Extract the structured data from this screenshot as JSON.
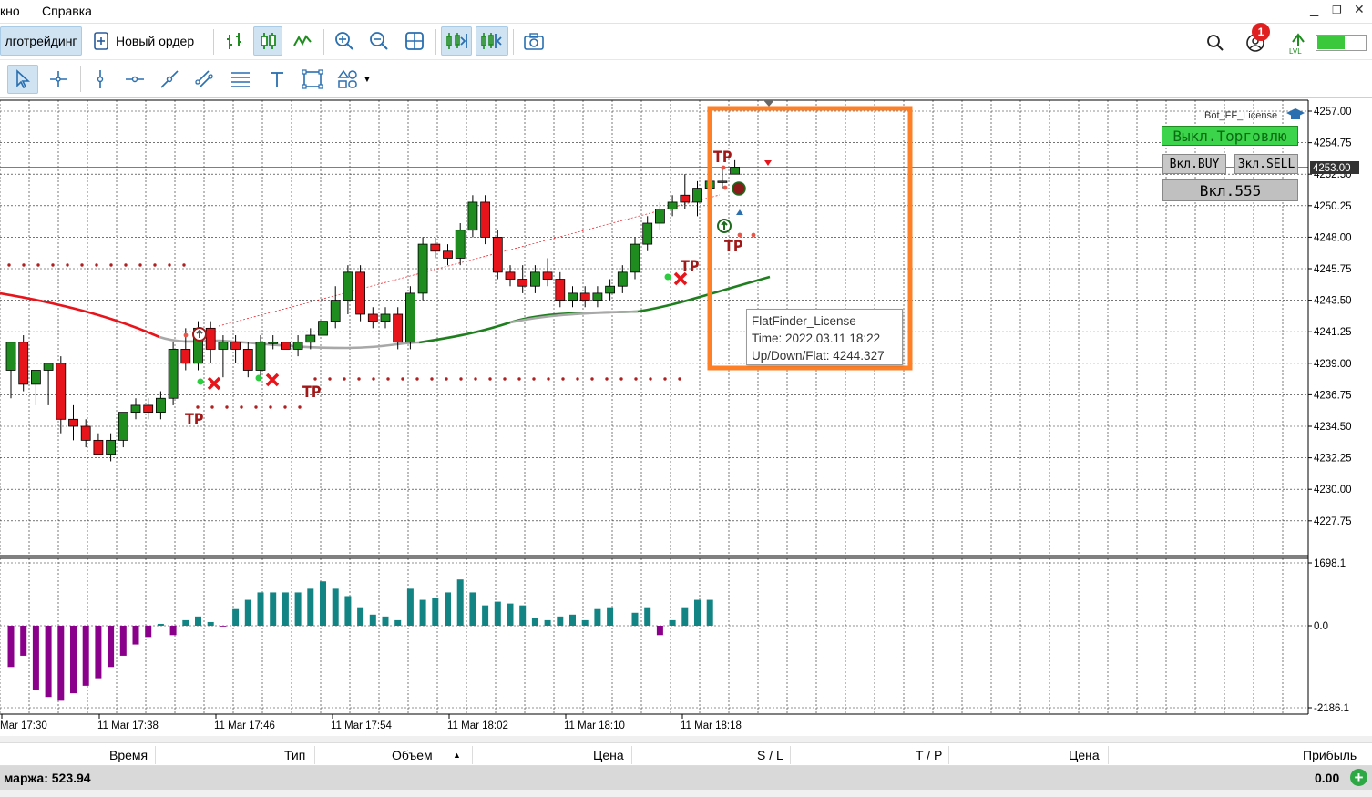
{
  "menu": {
    "window_label": "кно",
    "help_label": "Справка"
  },
  "toolbar": {
    "algo_trading_label": "лготрейдинг",
    "new_order_label": "Новый ордер",
    "notifications_count": "1"
  },
  "chart": {
    "price_axis": [
      "4257.00",
      "4254.75",
      "4252.50",
      "4250.25",
      "4248.00",
      "4245.75",
      "4243.50",
      "4241.25",
      "4239.00",
      "4236.75",
      "4234.50",
      "4232.25",
      "4230.00",
      "4227.75"
    ],
    "current_price": "4253.00",
    "indicator_axis": [
      "1698.1",
      "0.0",
      "-2186.1"
    ],
    "time_axis": [
      "Mar 17:30",
      "11 Mar 17:38",
      "11 Mar 17:46",
      "11 Mar 17:54",
      "11 Mar 18:02",
      "11 Mar 18:10",
      "11 Mar 18:18"
    ],
    "tp_label": "TP",
    "ea_name": "Bot_FF_License",
    "panel": {
      "disable_trading": "Выкл.Торговлю",
      "enable_buy": "Вкл.BUY",
      "enable_sell": "Зкл.SELL",
      "enable_555": "Вкл.555"
    },
    "tooltip": {
      "line1": "FlatFinder_License",
      "line2": "Time: 2022.03.11 18:22",
      "line3": "Up/Down/Flat: 4244.327"
    },
    "colors": {
      "up": "#1e8c1e",
      "down": "#e8141c",
      "highlight": "#ff7f27",
      "hist_pos": "#138484",
      "hist_neg": "#8b008b"
    }
  },
  "chart_data": {
    "type": "candlestick",
    "candles": [
      [
        4238.5,
        4240.5,
        4236.5,
        4240.5
      ],
      [
        4240.5,
        4241.0,
        4237.0,
        4237.5
      ],
      [
        4237.5,
        4238.0,
        4236.0,
        4238.5
      ],
      [
        4238.5,
        4239.0,
        4236.0,
        4239.0
      ],
      [
        4239.0,
        4239.5,
        4234.0,
        4235.0
      ],
      [
        4235.0,
        4236.0,
        4233.5,
        4234.5
      ],
      [
        4234.5,
        4235.0,
        4233.0,
        4233.5
      ],
      [
        4233.5,
        4234.0,
        4232.5,
        4232.5
      ],
      [
        4232.5,
        4234.0,
        4232.0,
        4233.5
      ],
      [
        4233.5,
        4235.5,
        4233.0,
        4235.5
      ],
      [
        4235.5,
        4236.5,
        4235.0,
        4236.0
      ],
      [
        4236.0,
        4236.5,
        4235.0,
        4235.5
      ],
      [
        4235.5,
        4237.0,
        4235.0,
        4236.5
      ],
      [
        4236.5,
        4240.5,
        4236.0,
        4240.0
      ],
      [
        4240.0,
        4241.5,
        4238.5,
        4239.0
      ],
      [
        4239.0,
        4242.0,
        4238.5,
        4241.5
      ],
      [
        4241.5,
        4242.0,
        4239.0,
        4240.0
      ],
      [
        4240.0,
        4241.0,
        4238.0,
        4240.5
      ],
      [
        4240.5,
        4241.0,
        4239.0,
        4240.0
      ],
      [
        4240.0,
        4240.5,
        4238.0,
        4238.5
      ],
      [
        4238.5,
        4241.0,
        4238.0,
        4240.5
      ],
      [
        4240.5,
        4241.0,
        4240.0,
        4240.5
      ],
      [
        4240.5,
        4240.5,
        4240.0,
        4240.0
      ],
      [
        4240.0,
        4241.0,
        4239.5,
        4240.5
      ],
      [
        4240.5,
        4241.5,
        4240.0,
        4241.0
      ],
      [
        4241.0,
        4242.5,
        4240.5,
        4242.0
      ],
      [
        4242.0,
        4244.5,
        4241.5,
        4243.5
      ],
      [
        4243.5,
        4246.0,
        4242.5,
        4245.5
      ],
      [
        4245.5,
        4246.0,
        4242.0,
        4242.5
      ],
      [
        4242.5,
        4243.0,
        4241.5,
        4242.0
      ],
      [
        4242.0,
        4243.0,
        4241.5,
        4242.5
      ],
      [
        4242.5,
        4243.0,
        4240.0,
        4240.5
      ],
      [
        4240.5,
        4244.5,
        4240.0,
        4244.0
      ],
      [
        4244.0,
        4248.0,
        4243.5,
        4247.5
      ],
      [
        4247.5,
        4248.0,
        4246.5,
        4247.0
      ],
      [
        4247.0,
        4247.5,
        4246.0,
        4246.5
      ],
      [
        4246.5,
        4249.0,
        4246.0,
        4248.5
      ],
      [
        4248.5,
        4251.0,
        4248.0,
        4250.5
      ],
      [
        4250.5,
        4251.0,
        4247.5,
        4248.0
      ],
      [
        4248.0,
        4248.5,
        4245.0,
        4245.5
      ],
      [
        4245.5,
        4246.0,
        4244.5,
        4245.0
      ],
      [
        4245.0,
        4246.0,
        4244.0,
        4244.5
      ],
      [
        4244.5,
        4246.0,
        4244.0,
        4245.5
      ],
      [
        4245.5,
        4246.5,
        4244.5,
        4245.0
      ],
      [
        4245.0,
        4245.5,
        4243.0,
        4243.5
      ],
      [
        4243.5,
        4244.5,
        4243.0,
        4244.0
      ],
      [
        4244.0,
        4244.5,
        4243.0,
        4243.5
      ],
      [
        4243.5,
        4244.5,
        4243.0,
        4244.0
      ],
      [
        4244.0,
        4245.0,
        4243.5,
        4244.5
      ],
      [
        4244.5,
        4246.0,
        4244.0,
        4245.5
      ],
      [
        4245.5,
        4248.0,
        4245.0,
        4247.5
      ],
      [
        4247.5,
        4249.5,
        4247.0,
        4249.0
      ],
      [
        4249.0,
        4250.5,
        4248.5,
        4250.0
      ],
      [
        4250.0,
        4251.0,
        4249.5,
        4250.5
      ],
      [
        4251.0,
        4252.5,
        4250.0,
        4250.5
      ],
      [
        4250.5,
        4252.0,
        4249.5,
        4251.5
      ],
      [
        4251.5,
        4252.5,
        4251.0,
        4252.0
      ],
      [
        4252.0,
        4253.0,
        4251.5,
        4252.0
      ],
      [
        4252.5,
        4253.5,
        4252.5,
        4253.0
      ]
    ],
    "histogram": [
      -1100,
      -800,
      -1700,
      -1900,
      -2000,
      -1800,
      -1600,
      -1400,
      -1100,
      -800,
      -500,
      -300,
      50,
      -250,
      150,
      250,
      100,
      -20,
      450,
      700,
      900,
      900,
      900,
      900,
      1000,
      1200,
      1000,
      800,
      500,
      300,
      250,
      150,
      1000,
      700,
      750,
      900,
      1250,
      900,
      550,
      650,
      600,
      550,
      200,
      150,
      250,
      300,
      150,
      450,
      500,
      0,
      350,
      500,
      -250,
      150,
      500,
      700,
      700,
      0,
      0
    ]
  },
  "positions": {
    "columns": [
      "Время",
      "Тип",
      "Объем",
      "Цена",
      "S / L",
      "T / P",
      "Цена",
      "Прибыль"
    ],
    "margin_label": "маржа: 523.94",
    "profit_total": "0.00"
  }
}
